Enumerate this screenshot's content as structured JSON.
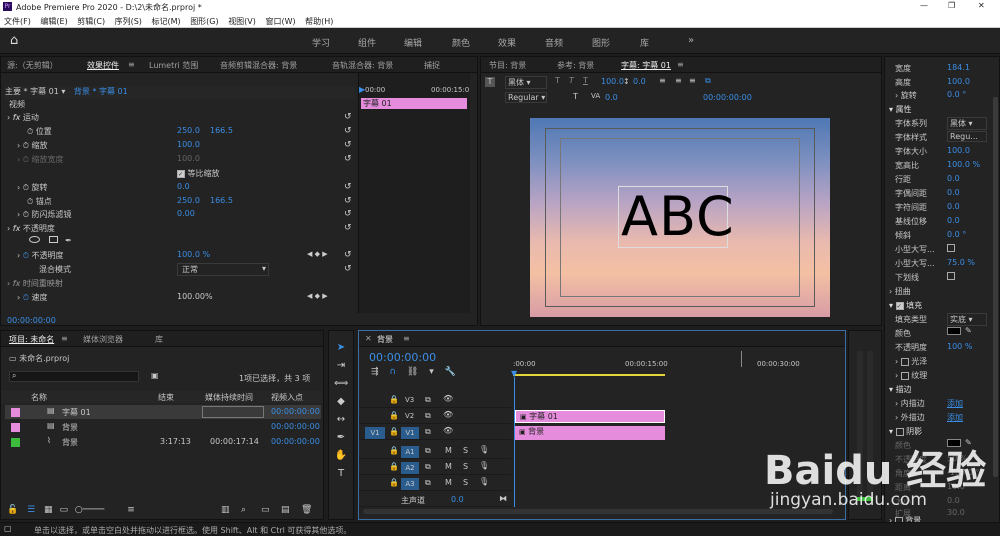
{
  "window": {
    "title": "Adobe Premiere Pro 2020 - D:\\2\\未命名.prproj *",
    "controls": [
      "—",
      "❐",
      "✕"
    ]
  },
  "menu": [
    "文件(F)",
    "编辑(E)",
    "剪辑(C)",
    "序列(S)",
    "标记(M)",
    "图形(G)",
    "视图(V)",
    "窗口(W)",
    "帮助(H)"
  ],
  "workspaces": [
    "学习",
    "组件",
    "编辑",
    "颜色",
    "效果",
    "音频",
    "图形",
    "库"
  ],
  "effects_panel": {
    "tabs": [
      "源:（无剪辑）",
      "效果控件",
      "Lumetri 范围",
      "音频剪辑混合器: 背景",
      "音轨混合器: 背景",
      "捕捉"
    ],
    "menu_icon": "≡",
    "clip_main": "主要 * 字幕 01",
    "clip_seq": "背景 * 字幕 01",
    "section_video": "视频",
    "fx_motion": "运动",
    "position": {
      "label": "位置",
      "x": "250.0",
      "y": "166.5"
    },
    "scale": {
      "label": "缩放",
      "value": "100.0"
    },
    "scale_width": {
      "label": "缩放宽度",
      "value": "100.0"
    },
    "uniform": "等比缩放",
    "rotation": {
      "label": "旋转",
      "value": "0.0"
    },
    "anchor": {
      "label": "锚点",
      "x": "250.0",
      "y": "166.5"
    },
    "antiflicker": {
      "label": "防闪烁滤镜",
      "value": "0.00"
    },
    "fx_opacity": "不透明度",
    "opacity": {
      "label": "不透明度",
      "value": "100.0 %"
    },
    "blend": {
      "label": "混合模式",
      "value": "正常"
    },
    "fx_timeremap": "时间重映射",
    "speed": {
      "label": "速度",
      "value": "100.00%"
    },
    "timecode": "00:00:00:00",
    "mini_times": [
      "00:00",
      "00:00:15:0"
    ],
    "mini_clip": "字幕 01"
  },
  "program": {
    "tabs": [
      "节目: 背景",
      "参考: 背景",
      "字幕: 字幕 01"
    ],
    "font": "黑体",
    "style": "Regular",
    "size": "100.0",
    "kerning": "0.0",
    "leading": "0.0",
    "tc": "00:00:00:00",
    "text": "ABC"
  },
  "properties": {
    "width": {
      "label": "宽度",
      "value": "184.1"
    },
    "height": {
      "label": "高度",
      "value": "100.0"
    },
    "rotate": {
      "label": "旋转",
      "value": "0.0 °"
    },
    "attr_title": "属性",
    "family": {
      "label": "字体系列",
      "value": "黑体"
    },
    "fstyle": {
      "label": "字体样式",
      "value": "Regu..."
    },
    "fsize": {
      "label": "字体大小",
      "value": "100.0"
    },
    "aspect": {
      "label": "宽高比",
      "value": "100.0 %"
    },
    "leading": {
      "label": "行距",
      "value": "0.0"
    },
    "tracking": {
      "label": "字偶间距",
      "value": "0.0"
    },
    "kern": {
      "label": "字符间距",
      "value": "0.0"
    },
    "baseline": {
      "label": "基线位移",
      "value": "0.0"
    },
    "tilt": {
      "label": "倾斜",
      "value": "0.0 °"
    },
    "smallcaps": {
      "label": "小型大写..."
    },
    "smallcaps_size": {
      "label": "小型大写...",
      "value": "75.0 %"
    },
    "underline": {
      "label": "下划线"
    },
    "distort": "扭曲",
    "fill": "填充",
    "fill_type": {
      "label": "填充类型",
      "value": "实底"
    },
    "color": {
      "label": "颜色"
    },
    "opacity": {
      "label": "不透明度",
      "value": "100 %"
    },
    "gloss": "光泽",
    "texture": "纹理",
    "stroke": "描边",
    "inner": {
      "label": "内描边",
      "value": "添加"
    },
    "outer": {
      "label": "外描边",
      "value": "添加"
    },
    "shadow": "阴影",
    "shadow_color": "颜色",
    "shadow_opacity": {
      "label": "不透明度",
      "value": "50 %"
    },
    "shadow_angle": {
      "label": "角度",
      "value": "-135.0 °"
    },
    "shadow_distance": {
      "label": "距离",
      "value": "10.0"
    },
    "shadow_size": {
      "label": "大小",
      "value": "0.0"
    },
    "shadow_spread": {
      "label": "扩展",
      "value": "30.0"
    },
    "background": "背景"
  },
  "project": {
    "tabs": [
      "项目: 未命名",
      "媒体浏览器",
      "库"
    ],
    "file": "未命名.prproj",
    "count": "1项已选择，共 3 项",
    "cols": [
      "名称",
      "结束",
      "媒体持续时间",
      "视频入点"
    ],
    "rows": [
      {
        "name": "字幕 01",
        "end": "",
        "dur": "",
        "in": "00:00:00:00",
        "color": "#e58ddc"
      },
      {
        "name": "背景",
        "end": "",
        "dur": "",
        "in": "00:00:00:00",
        "color": "#e58ddc"
      },
      {
        "name": "背景",
        "end": "3:17:13",
        "dur": "00:00:17:14",
        "in": "00:00:00:00",
        "color": "#3dbb3d"
      }
    ]
  },
  "timeline": {
    "tab": "背景",
    "tc": "00:00:00:00",
    "ruler": [
      ":00:00",
      "00:00:15:00",
      "00:00:30:00"
    ],
    "tracks": [
      "V3",
      "V2",
      "V1",
      "A1",
      "A2",
      "A3"
    ],
    "src_v": "V1",
    "clip_title": "字幕 01",
    "clip_bg": "背景",
    "master": "主声道",
    "master_val": "0.0"
  },
  "status": "单击以选择，或单击空白处并拖动以进行框选。使用 Shift、Alt 和 Ctrl 可获得其他选项。",
  "watermark": "Baidu 经验",
  "watermark_url": "jingyan.baidu.com",
  "colors": {
    "accent": "#3a8ee6",
    "clip": "#e58ddc",
    "green": "#3dbb3d"
  }
}
